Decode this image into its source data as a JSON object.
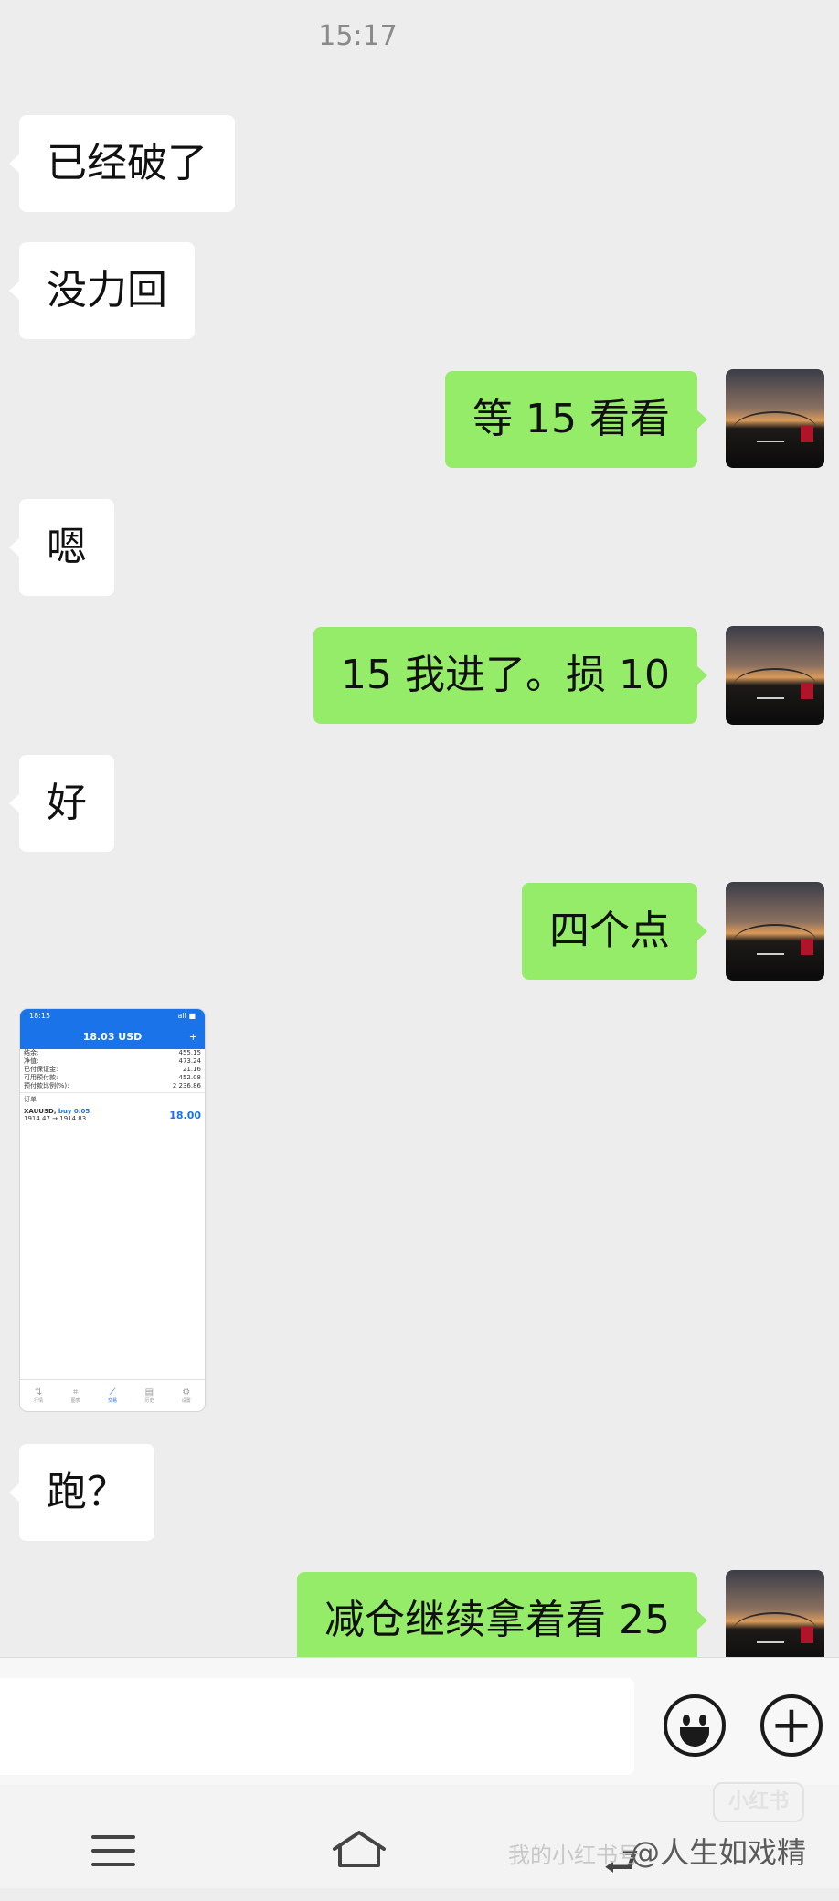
{
  "chat": {
    "timestamp": "15:17",
    "messages": [
      {
        "side": "left",
        "text": "已经破了"
      },
      {
        "side": "left",
        "text": "没力回"
      },
      {
        "side": "right",
        "text": "等 15 看看"
      },
      {
        "side": "left",
        "text": "嗯"
      },
      {
        "side": "right",
        "text": "15 我进了。损 10"
      },
      {
        "side": "left",
        "text": "好"
      },
      {
        "side": "right",
        "text": "四个点"
      },
      {
        "side": "left",
        "type": "image"
      },
      {
        "side": "left",
        "text": "跑？"
      },
      {
        "side": "right",
        "text": "减仓继续拿着看 25"
      }
    ]
  },
  "screenshot": {
    "status_time": "18:15",
    "status_icons": "all ■",
    "title": "18.03 USD",
    "plus": "+",
    "rows": [
      {
        "label": "结余:",
        "value": "455.15"
      },
      {
        "label": "净值:",
        "value": "473.24"
      },
      {
        "label": "已付保证金:",
        "value": "21.16"
      },
      {
        "label": "可用预付款:",
        "value": "452.08"
      },
      {
        "label": "预付款比例(%):",
        "value": "2 236.86"
      }
    ],
    "section": "订单",
    "position_symbol": "XAUUSD,",
    "position_side": "buy 0.05",
    "position_prices": "1914.47 → 1914.83",
    "position_pnl": "18.00",
    "tabs": [
      {
        "icon": "⇅",
        "label": "行情"
      },
      {
        "icon": "⌗",
        "label": "图表"
      },
      {
        "icon": "⟋",
        "label": "交易"
      },
      {
        "icon": "▤",
        "label": "历史"
      },
      {
        "icon": "⚙",
        "label": "设置"
      }
    ]
  },
  "input_bar": {
    "emoji_icon": "smiley-icon",
    "plus_symbol": "+"
  },
  "nav_bar": {
    "back_symbol": "⮐"
  },
  "watermark": {
    "logo_text": "小红书",
    "left_text": "我的小红书号",
    "right_text": "@人生如戏精"
  }
}
